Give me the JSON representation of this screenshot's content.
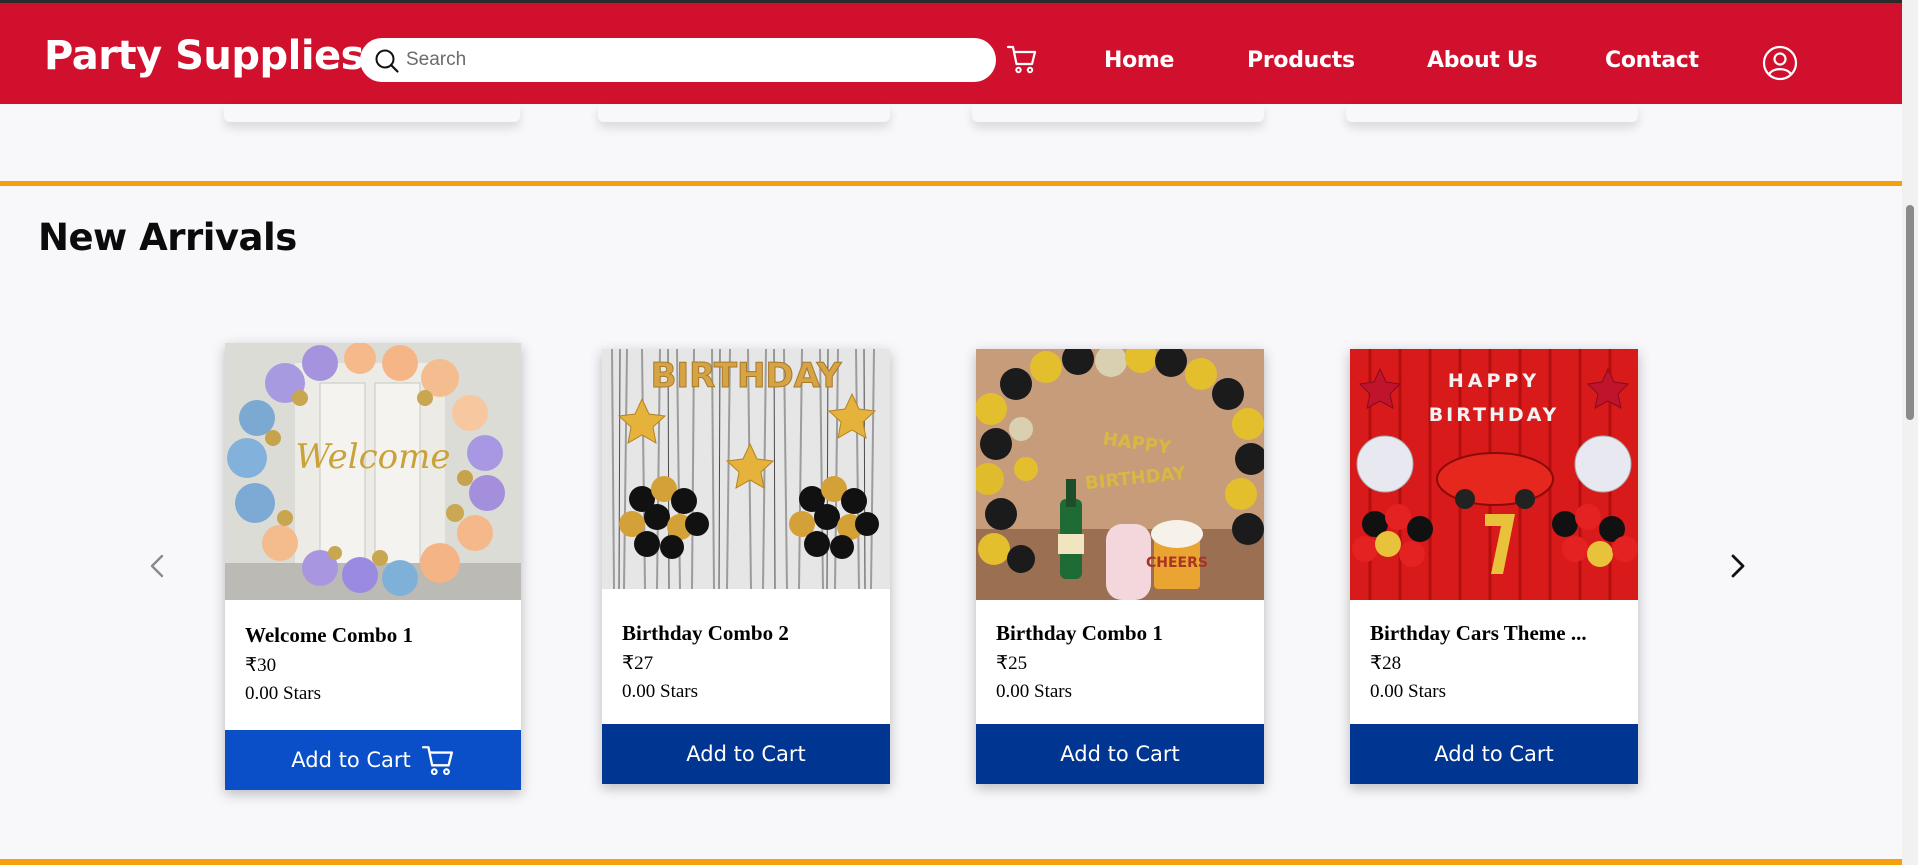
{
  "header": {
    "brand": "Party Supplies",
    "search_placeholder": "Search",
    "nav": [
      "Home",
      "Products",
      "About Us",
      "Contact"
    ],
    "color": "#d0102d"
  },
  "section": {
    "title": "New Arrivals"
  },
  "products": [
    {
      "name": "Welcome Combo 1",
      "price": "₹30",
      "stars": "0.00 Stars",
      "button": "Add to Cart"
    },
    {
      "name": "Birthday Combo 2",
      "price": "₹27",
      "stars": "0.00 Stars",
      "button": "Add to Cart"
    },
    {
      "name": "Birthday Combo 1",
      "price": "₹25",
      "stars": "0.00 Stars",
      "button": "Add to Cart"
    },
    {
      "name": "Birthday Cars Theme ...",
      "price": "₹28",
      "stars": "0.00 Stars",
      "button": "Add to Cart"
    }
  ],
  "colors": {
    "button_active": "#0a4fc8",
    "button": "#003591",
    "accent": "#f5a00c"
  }
}
